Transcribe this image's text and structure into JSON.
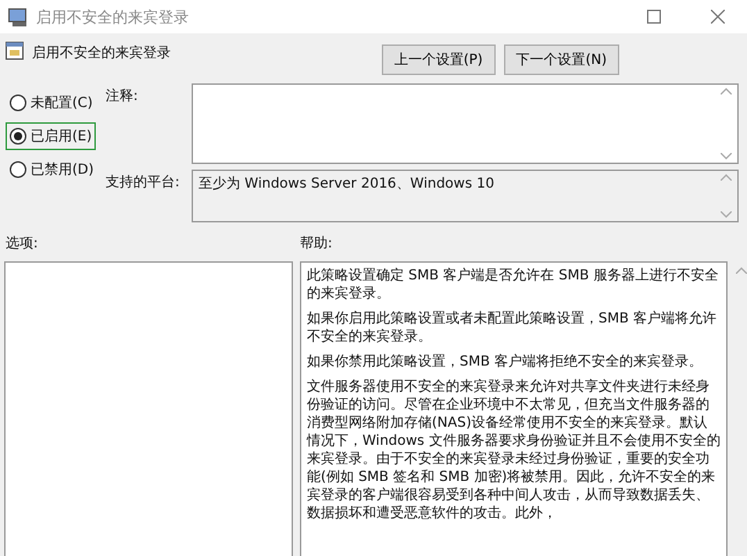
{
  "window": {
    "title": "启用不安全的来宾登录"
  },
  "header": {
    "title": "启用不安全的来宾登录",
    "buttons": [
      "上一个设置(P)",
      "下一个设置(N)"
    ]
  },
  "radios": [
    {
      "label": "未配置(C)",
      "selected": false
    },
    {
      "label": "已启用(E)",
      "selected": true
    },
    {
      "label": "已禁用(D)",
      "selected": false
    }
  ],
  "comment": {
    "label": "注释:"
  },
  "platform": {
    "label": "支持的平台:",
    "value": "至少为 Windows Server 2016、Windows 10"
  },
  "options": {
    "label": "选项:"
  },
  "help": {
    "label": "帮助:",
    "paragraphs": [
      "此策略设置确定 SMB 客户端是否允许在 SMB 服务器上进行不安全的来宾登录。",
      "如果你启用此策略设置或者未配置此策略设置，SMB 客户端将允许不安全的来宾登录。",
      "如果你禁用此策略设置，SMB 客户端将拒绝不安全的来宾登录。",
      "文件服务器使用不安全的来宾登录来允许对共享文件夹进行未经身份验证的访问。尽管在企业环境中不太常见，但充当文件服务器的消费型网络附加存储(NAS)设备经常使用不安全的来宾登录。默认情况下，Windows 文件服务器要求身份验证并且不会使用不安全的来宾登录。由于不安全的来宾登录未经过身份验证，重要的安全功能(例如 SMB 签名和 SMB 加密)将被禁用。因此，允许不安全的来宾登录的客户端很容易受到各种中间人攻击，从而导致数据丢失、数据损坏和遭受恶意软件的攻击。此外，"
    ]
  }
}
